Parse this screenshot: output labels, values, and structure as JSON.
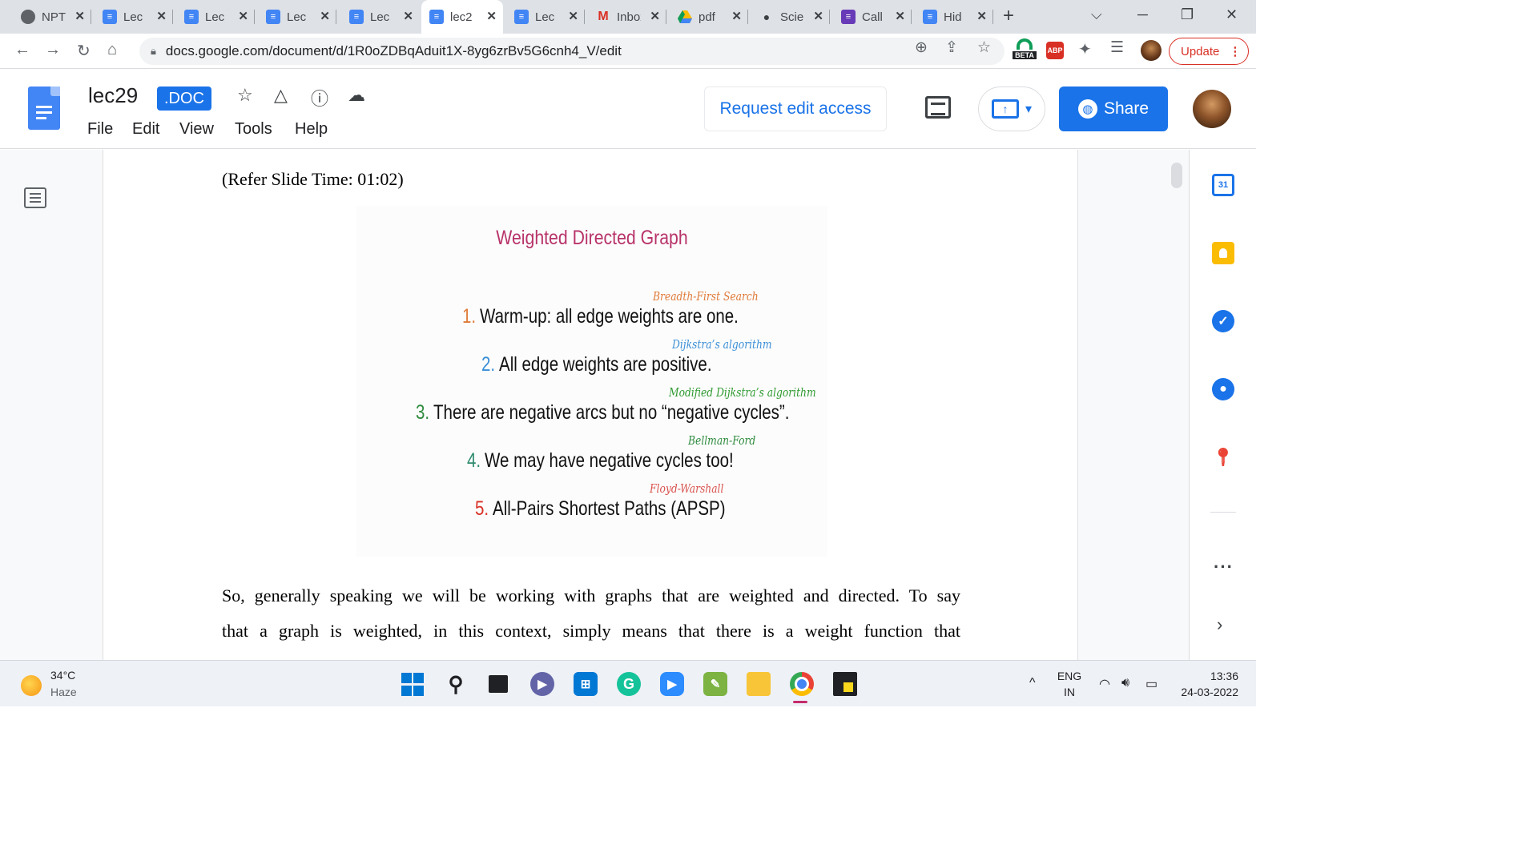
{
  "browser": {
    "tabs": [
      {
        "title": "NPTEL",
        "favicon": "globe-icon",
        "active": false
      },
      {
        "title": "Lec",
        "favicon": "docs-icon",
        "active": false
      },
      {
        "title": "Lec",
        "favicon": "docs-icon",
        "active": false
      },
      {
        "title": "Lec",
        "favicon": "docs-icon",
        "active": false
      },
      {
        "title": "Lec",
        "favicon": "docs-icon",
        "active": false
      },
      {
        "title": "lec2",
        "favicon": "docs-icon",
        "active": true
      },
      {
        "title": "Lec",
        "favicon": "docs-icon",
        "active": false
      },
      {
        "title": "Inbox",
        "favicon": "gmail-icon",
        "active": false
      },
      {
        "title": "pdf",
        "favicon": "drive-icon",
        "active": false
      },
      {
        "title": "Scie",
        "favicon": "chat-icon",
        "active": false
      },
      {
        "title": "Call",
        "favicon": "forms-icon",
        "active": false
      },
      {
        "title": "Hid",
        "favicon": "docs-icon",
        "active": false
      }
    ],
    "url": "docs.google.com/document/d/1R0oZDBqAduit1X-8yg6zrBv5G6cnh4_V/edit",
    "extensions": {
      "beta_label": "BETA",
      "abp_label": "ABP"
    },
    "update_label": "Update"
  },
  "docs": {
    "title": "lec29",
    "badge": ".DOC",
    "menu": [
      "File",
      "Edit",
      "View",
      "Tools",
      "Help"
    ],
    "request_access_label": "Request edit access",
    "share_label": "Share"
  },
  "document": {
    "refer_line": "(Refer Slide Time: 01:02)",
    "slide": {
      "title": "Weighted Directed Graph",
      "items": [
        {
          "num": "1.",
          "text": "Warm-up: all edge weights are one.",
          "num_color": "#e07b39",
          "note": "Breadth-First Search",
          "note_color": "#e07b39"
        },
        {
          "num": "2.",
          "text": "All edge weights are positive.",
          "num_color": "#3b8fd6",
          "note": "Dijkstra’s algorithm",
          "note_color": "#3b8fd6"
        },
        {
          "num": "3.",
          "text": "There are negative arcs but no “negative cycles”.",
          "num_color": "#2e8b3e",
          "note": "Modified Dijkstra’s algorithm",
          "note_color": "#2e9a30"
        },
        {
          "num": "4.",
          "text": "We may have negative cycles too!",
          "num_color": "#2e8b6e",
          "note": "Bellman-Ford",
          "note_color": "#2e8b3e"
        },
        {
          "num": "5.",
          "text": "All-Pairs Shortest Paths (APSP)",
          "num_color": "#d93025",
          "note": "Floyd-Warshall",
          "note_color": "#d9534f"
        }
      ]
    },
    "paragraph_lines": [
      "So, generally speaking we will be working with graphs that are weighted and directed. To say",
      "that a graph is weighted, in this context, simply means that there is a weight function that"
    ]
  },
  "sidepanel": {
    "calendar_day": "31",
    "items": [
      "calendar-icon",
      "keep-icon",
      "tasks-icon",
      "contacts-icon",
      "maps-icon"
    ]
  },
  "taskbar": {
    "weather_temp": "34°C",
    "weather_cond": "Haze",
    "lang_1": "ENG",
    "lang_2": "IN",
    "time": "13:36",
    "date": "24-03-2022"
  }
}
